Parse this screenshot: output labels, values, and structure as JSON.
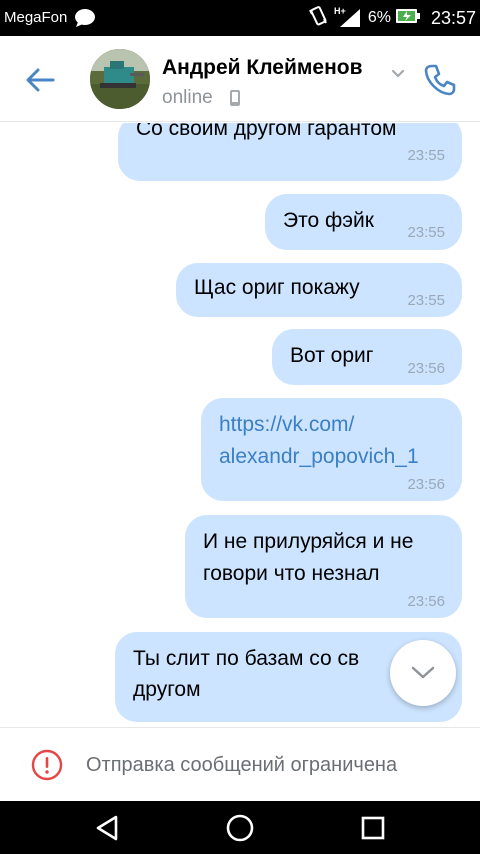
{
  "status_bar": {
    "carrier": "MegaFon",
    "network": "H+",
    "battery_percent": "6%",
    "time": "23:57",
    "icons": [
      "chat-bubble-icon",
      "vibrate-icon",
      "signal-icon",
      "battery-icon"
    ]
  },
  "header": {
    "contact_name": "Андрей Клейменов",
    "status": "online",
    "icons": [
      "back-arrow-icon",
      "chevron-down-icon",
      "mobile-icon",
      "phone-icon"
    ]
  },
  "messages": [
    {
      "lines": [
        "Со своим другом гарантом"
      ],
      "time": "23:55",
      "is_link": false
    },
    {
      "lines": [
        "Это фэйк"
      ],
      "time": "23:55",
      "is_link": false
    },
    {
      "lines": [
        "Щас ориг покажу"
      ],
      "time": "23:55",
      "is_link": false
    },
    {
      "lines": [
        "Вот ориг"
      ],
      "time": "23:56",
      "is_link": false
    },
    {
      "lines": [
        "https://vk.com/",
        "alexandr_popovich_1"
      ],
      "time": "23:56",
      "is_link": true
    },
    {
      "lines": [
        "И не прилуряйся и не",
        "говори что незнал"
      ],
      "time": "23:56",
      "is_link": false
    },
    {
      "lines": [
        "Ты слит по базам со св",
        "другом"
      ],
      "time": "",
      "is_link": false
    }
  ],
  "restriction": {
    "text": "Отправка сообщений ограничена",
    "icon": "alert-circle-icon",
    "color": "#e64646"
  },
  "colors": {
    "accent": "#4a86c5",
    "bubble": "#cce4ff",
    "link": "#3b7fc4"
  },
  "nav_bar": {
    "icons": [
      "back-triangle-icon",
      "home-circle-icon",
      "recents-square-icon"
    ]
  }
}
